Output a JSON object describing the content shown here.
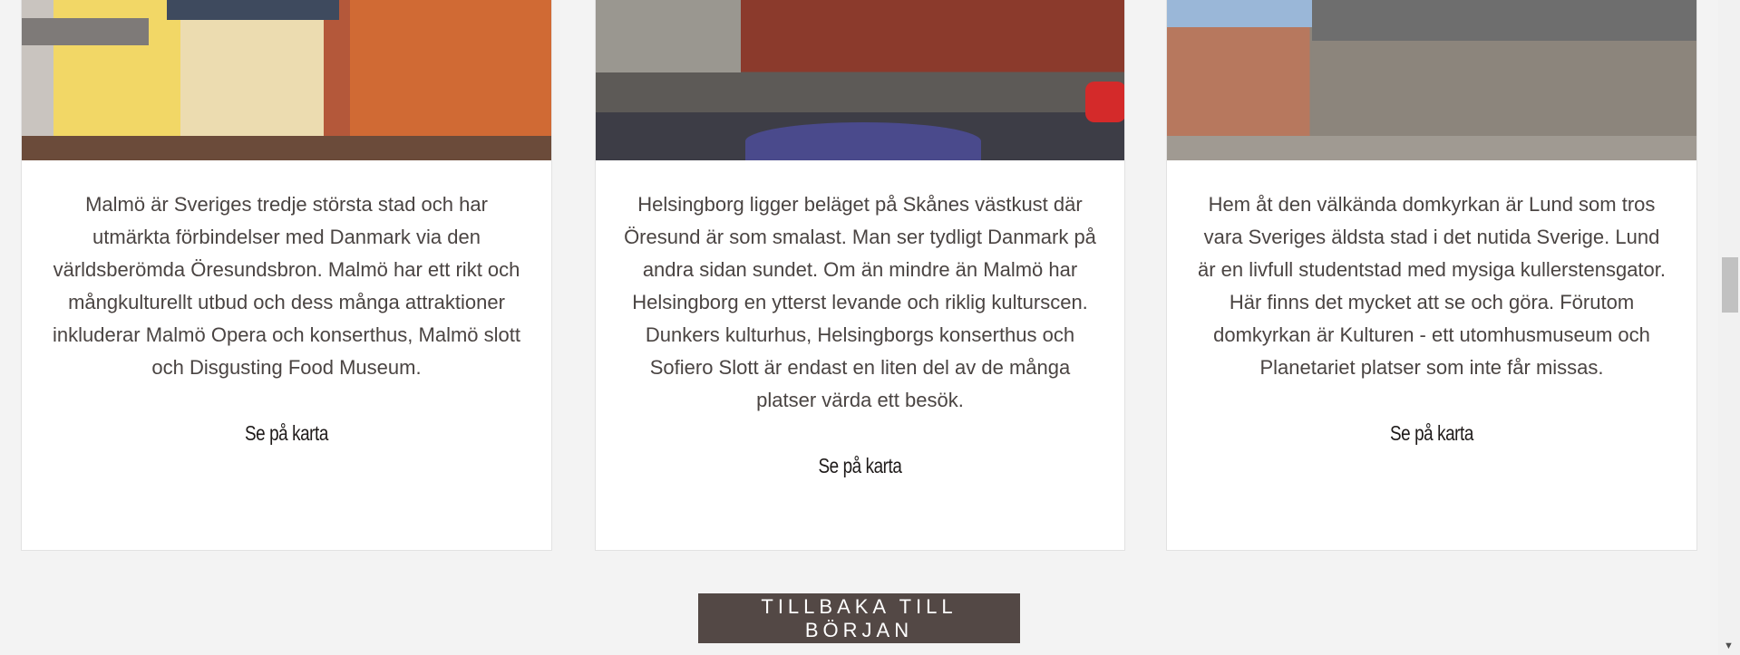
{
  "cards": [
    {
      "image_alt": "Malmö street with colourful buildings",
      "text": "Malmö är Sveriges tredje största stad och har utmärkta förbindelser med Danmark via den världsberömda Öresundsbron. Malmö har ett rikt och mångkulturellt utbud och dess många attraktioner inkluderar Malmö Opera och konserthus, Malmö slott och Disgusting Food Museum.",
      "link": "Se på karta"
    },
    {
      "image_alt": "Helsingborg town hall square",
      "text": "Helsingborg ligger beläget på Skånes västkust där Öresund är som smalast. Man ser tydligt Danmark på andra sidan sundet. Om än mindre än Malmö har Helsingborg en ytterst levande och riklig kulturscen. Dunkers kulturhus, Helsingborgs konserthus och Sofiero Slott är endast en liten del av de många platser värda ett besök.",
      "link": "Se på karta"
    },
    {
      "image_alt": "Lund cathedral",
      "text": "Hem åt den välkända domkyrkan är Lund som tros vara Sveriges äldsta stad i det nutida Sverige. Lund är en livfull studentstad med mysiga kullerstensgator. Här finns det mycket att se och göra. Förutom domkyrkan är Kulturen - ett utomhusmuseum och Planetariet platser som inte får missas.",
      "link": "Se på karta"
    }
  ],
  "back_to_top": "TILLBAKA TILL BÖRJAN",
  "colors": {
    "button_bg": "#534845",
    "page_bg": "#f3f3f3",
    "text": "#4a4442"
  },
  "scrollbar": {
    "arrow_icon": "triangle-down"
  }
}
